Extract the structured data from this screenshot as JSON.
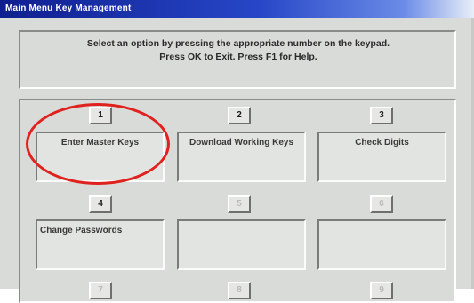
{
  "window": {
    "title": "Main Menu Key Management"
  },
  "message": {
    "line1": "Select an option by pressing the appropriate number on the keypad.",
    "line2": "Press OK to Exit.  Press F1 for Help."
  },
  "options": [
    {
      "number": "1",
      "label": "Enter Master Keys"
    },
    {
      "number": "2",
      "label": "Download Working Keys"
    },
    {
      "number": "3",
      "label": "Check Digits"
    },
    {
      "number": "4",
      "label": "Change Passwords"
    },
    {
      "number": "5",
      "label": ""
    },
    {
      "number": "6",
      "label": ""
    },
    {
      "number": "7",
      "label": ""
    },
    {
      "number": "8",
      "label": ""
    },
    {
      "number": "9",
      "label": ""
    }
  ],
  "colors": {
    "highlight_circle": "#e0221f",
    "titlebar": "#1b3aa6"
  }
}
